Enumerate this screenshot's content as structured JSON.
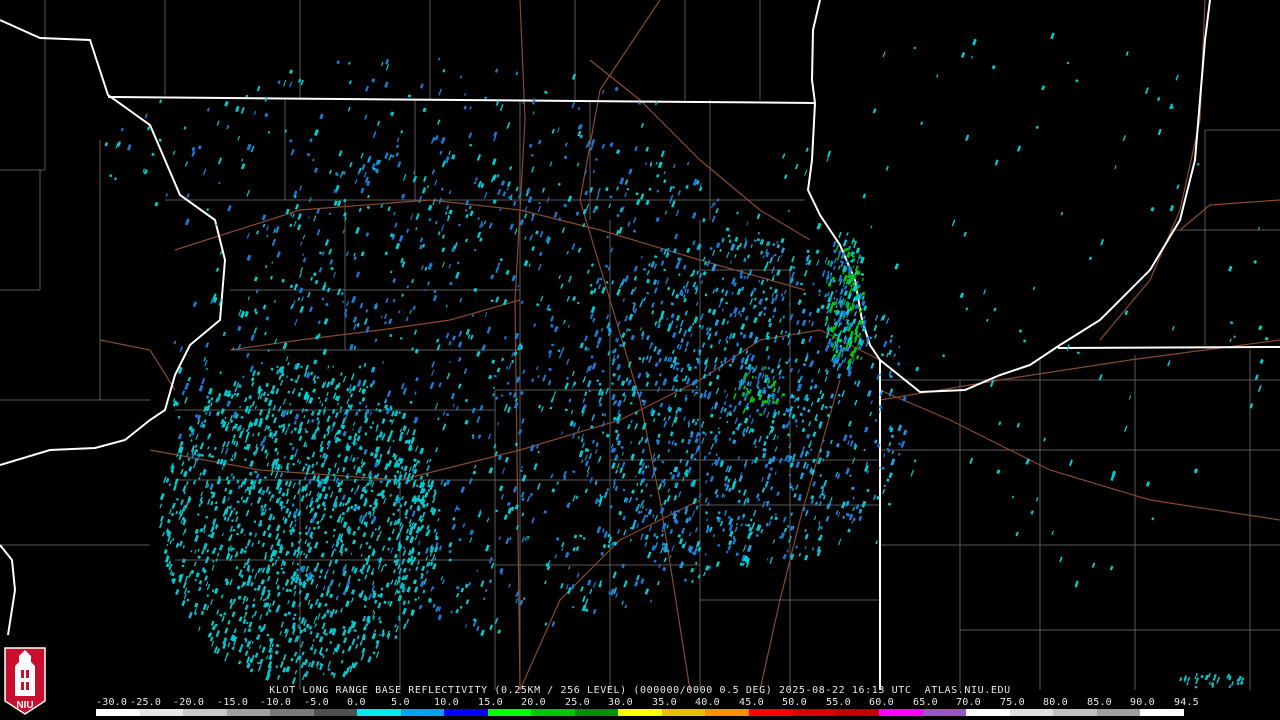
{
  "product": {
    "caption": "KLOT LONG RANGE BASE REFLECTIVITY (0.25KM / 256 LEVEL) (000000/0000 0.5 DEG) 2025-08-22 16:13 UTC  ATLAS.NIU.EDU"
  },
  "scale": {
    "labels": [
      "-30.0",
      "-25.0",
      "-20.0",
      "-15.0",
      "-10.0",
      "-5.0",
      "0.0",
      "5.0",
      "10.0",
      "15.0",
      "20.0",
      "25.0",
      "30.0",
      "35.0",
      "40.0",
      "45.0",
      "50.0",
      "55.0",
      "60.0",
      "65.0",
      "70.0",
      "75.0",
      "80.0",
      "85.0",
      "90.0",
      "94.5"
    ],
    "colors": [
      "#ffffff",
      "#e6e6e6",
      "#c8c8c8",
      "#a0a0a0",
      "#7a7a7a",
      "#505050",
      "#00e8ec",
      "#00a0f6",
      "#0000f6",
      "#00ff00",
      "#00c800",
      "#009000",
      "#ffff00",
      "#e7c000",
      "#ff9000",
      "#ff0000",
      "#d60000",
      "#c00000",
      "#ff00ff",
      "#9955c9",
      "#ffffff",
      "#e0e0e0",
      "#c0c0c0",
      "#a0a0a0",
      "#ffffff"
    ]
  },
  "logo": {
    "text": "NIU",
    "icon": "niu-tower-logo-icon"
  },
  "colors": {
    "background": "#000000",
    "state_borders": "#ffffff",
    "county_lines": "#5a5a5a",
    "roads": "#8b4a2b",
    "echo_light": "#00cdd0",
    "echo_mid": "#1a7bd6",
    "echo_strong": "#00c800"
  }
}
